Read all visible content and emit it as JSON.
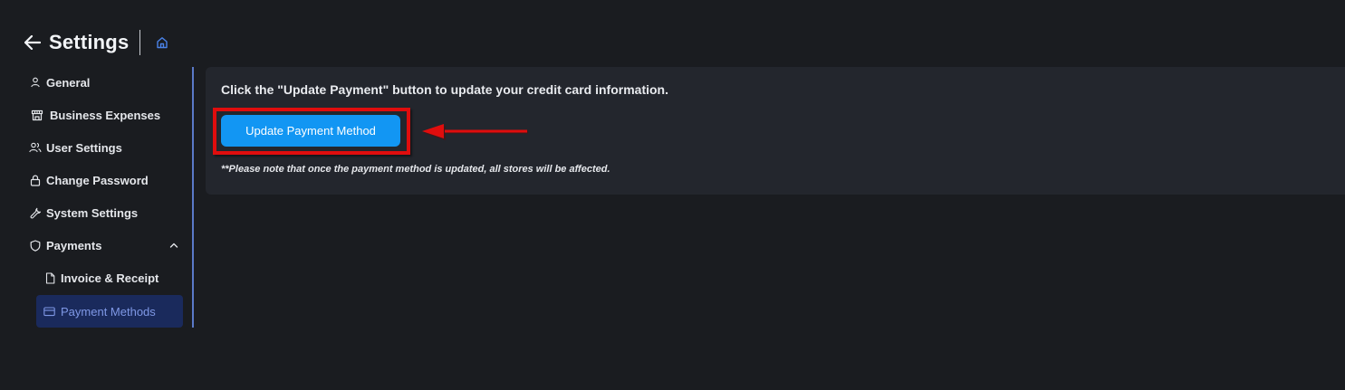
{
  "header": {
    "title": "Settings",
    "back_icon": "arrow-left-icon",
    "home_icon": "home-icon"
  },
  "sidebar": {
    "items": [
      {
        "label": "General",
        "icon": "user-icon"
      },
      {
        "label": "Business Expenses",
        "icon": "store-icon"
      },
      {
        "label": "User Settings",
        "icon": "users-icon"
      },
      {
        "label": "Change Password",
        "icon": "lock-icon"
      },
      {
        "label": "System Settings",
        "icon": "wrench-icon"
      },
      {
        "label": "Payments",
        "icon": "shield-icon",
        "expanded": true
      },
      {
        "label": "Invoice & Receipt",
        "icon": "file-icon"
      },
      {
        "label": "Payment Methods",
        "icon": "credit-card-icon",
        "active": true
      }
    ]
  },
  "main": {
    "instruction": "Click the \"Update Payment\" button to update your credit card information.",
    "button_label": "Update Payment Method",
    "note": "**Please note that once the payment method is updated, all stores will be affected."
  },
  "colors": {
    "background": "#1a1c20",
    "panel": "#23262d",
    "accent": "#1296f3",
    "active_bg": "#1a2a5c",
    "active_text": "#7f98e6",
    "annotation_red": "#e00d0d",
    "sidebar_border": "#5a79c8"
  }
}
